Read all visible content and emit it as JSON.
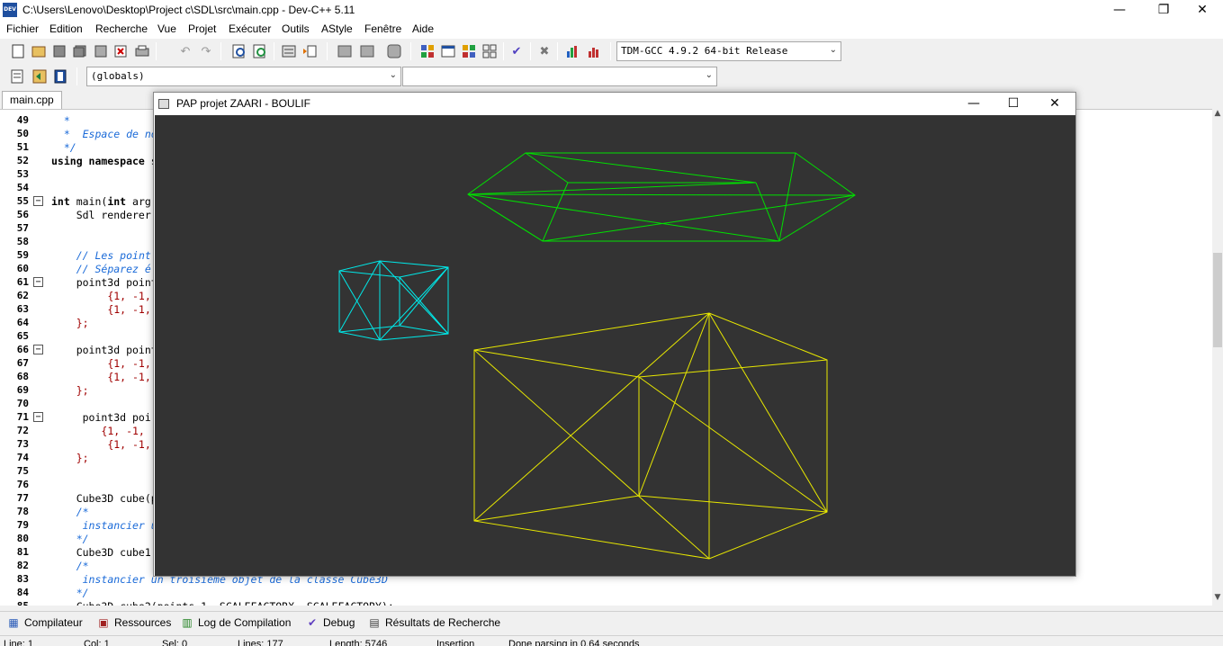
{
  "window": {
    "title": "C:\\Users\\Lenovo\\Desktop\\Project c\\SDL\\src\\main.cpp - Dev-C++ 5.11",
    "icon_label": "DEV",
    "minimize": "—",
    "maximize": "❐",
    "close": "✕"
  },
  "menu": [
    "Fichier",
    "Edition",
    "Recherche",
    "Vue",
    "Projet",
    "Exécuter",
    "Outils",
    "AStyle",
    "Fenêtre",
    "Aide"
  ],
  "toolbar": {
    "compiler_select": "TDM-GCC 4.9.2 64-bit Release",
    "scope_select": "(globals)",
    "member_select": ""
  },
  "editor": {
    "tab_label": "main.cpp",
    "lines": [
      {
        "n": "49",
        "fold": "",
        "html": "  <span class='cm'>*</span>"
      },
      {
        "n": "50",
        "fold": "",
        "html": "  <span class='cm'>*  Espace de no</span>"
      },
      {
        "n": "51",
        "fold": "",
        "html": "  <span class='cm'>*/</span>"
      },
      {
        "n": "52",
        "fold": "",
        "html": "<span class='kw'>using namespace</span> s"
      },
      {
        "n": "53",
        "fold": "",
        "html": ""
      },
      {
        "n": "54",
        "fold": "",
        "html": ""
      },
      {
        "n": "55",
        "fold": "−",
        "html": "<span class='kw'>int</span> main(<span class='kw'>int</span> arg"
      },
      {
        "n": "56",
        "fold": "",
        "html": "    Sdl renderer"
      },
      {
        "n": "57",
        "fold": "",
        "html": ""
      },
      {
        "n": "58",
        "fold": "",
        "html": ""
      },
      {
        "n": "59",
        "fold": "",
        "html": "    <span class='cm'>// Les point</span>"
      },
      {
        "n": "60",
        "fold": "",
        "html": "    <span class='cm'>// Séparez é</span>"
      },
      {
        "n": "61",
        "fold": "−",
        "html": "    point3d point"
      },
      {
        "n": "62",
        "fold": "",
        "html": "         <span class='nm'>{1, -1,</span>"
      },
      {
        "n": "63",
        "fold": "",
        "html": "         <span class='nm'>{1, -1,</span>"
      },
      {
        "n": "64",
        "fold": "",
        "html": "    <span class='nm'>};</span>"
      },
      {
        "n": "65",
        "fold": "",
        "html": ""
      },
      {
        "n": "66",
        "fold": "−",
        "html": "    point3d point"
      },
      {
        "n": "67",
        "fold": "",
        "html": "         <span class='nm'>{1, -1,</span>"
      },
      {
        "n": "68",
        "fold": "",
        "html": "         <span class='nm'>{1, -1,</span>"
      },
      {
        "n": "69",
        "fold": "",
        "html": "    <span class='nm'>};</span>"
      },
      {
        "n": "70",
        "fold": "",
        "html": ""
      },
      {
        "n": "71",
        "fold": "−",
        "html": "     point3d poi"
      },
      {
        "n": "72",
        "fold": "",
        "html": "        <span class='nm'>{1, -1, </span>"
      },
      {
        "n": "73",
        "fold": "",
        "html": "         <span class='nm'>{1, -1,</span>"
      },
      {
        "n": "74",
        "fold": "",
        "html": "    <span class='nm'>};</span>"
      },
      {
        "n": "75",
        "fold": "",
        "html": ""
      },
      {
        "n": "76",
        "fold": "",
        "html": ""
      },
      {
        "n": "77",
        "fold": "",
        "html": "    Cube3D cube(p"
      },
      {
        "n": "78",
        "fold": "",
        "html": "    <span class='cm'>/*</span>"
      },
      {
        "n": "79",
        "fold": "",
        "html": "     <span class='cm'>instancier u</span>"
      },
      {
        "n": "80",
        "fold": "",
        "html": "    <span class='cm'>*/</span>"
      },
      {
        "n": "81",
        "fold": "",
        "html": "    Cube3D cube1"
      },
      {
        "n": "82",
        "fold": "",
        "html": "    <span class='cm'>/*</span>"
      },
      {
        "n": "83",
        "fold": "",
        "html": "     <span class='cm'>instancier un troisieme objet de la classe Cube3D</span>"
      },
      {
        "n": "84",
        "fold": "",
        "html": "    <span class='cm'>*/</span>"
      },
      {
        "n": "85",
        "fold": "",
        "html": "    Cube3D cube2(points_1, SCALEFACTORX, SCALEFACTORY);"
      }
    ]
  },
  "bottom_tabs": [
    {
      "label": "Compilateur",
      "icon": "compiler-icon",
      "glyph": "▦",
      "color": "#2a5bb8"
    },
    {
      "label": "Ressources",
      "icon": "resources-icon",
      "glyph": "▣",
      "color": "#a02020"
    },
    {
      "label": "Log de Compilation",
      "icon": "chart-icon",
      "glyph": "▥",
      "color": "#208020"
    },
    {
      "label": "Debug",
      "icon": "check-icon",
      "glyph": "✔",
      "color": "#6040c0"
    },
    {
      "label": "Résultats de Recherche",
      "icon": "search-results-icon",
      "glyph": "▤",
      "color": "#404040"
    }
  ],
  "status": {
    "line": "Line:    1",
    "col": "Col:    1",
    "sel": "Sel:    0",
    "lines": "Lines:   177",
    "length": "Length:  5746",
    "mode": "Insertion",
    "message": "Done parsing in 0.64 seconds"
  },
  "sdl_window": {
    "title": "PAP projet ZAARI - BOULIF",
    "minimize": "—",
    "maximize": "☐",
    "close": "✕",
    "background": "#333333",
    "shapes": [
      {
        "name": "green-wireframe",
        "color": "#00e000"
      },
      {
        "name": "cyan-wireframe",
        "color": "#00e8e8"
      },
      {
        "name": "yellow-wireframe",
        "color": "#e8e800"
      }
    ]
  }
}
